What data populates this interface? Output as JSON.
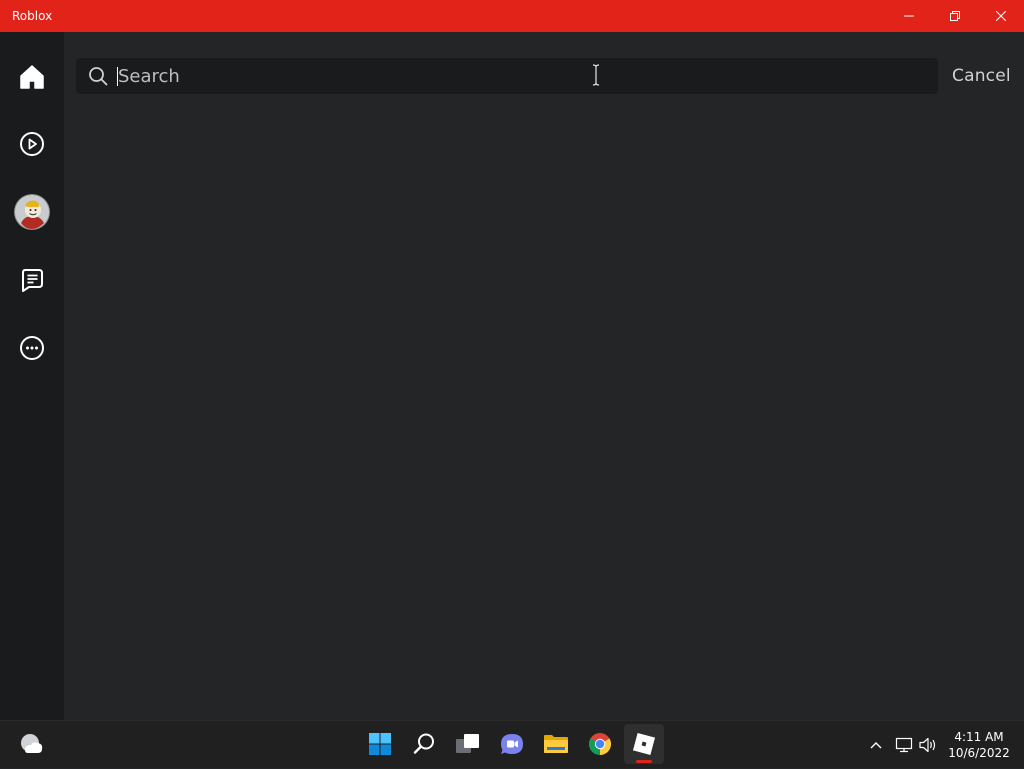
{
  "window": {
    "title": "Roblox",
    "accent_color": "#e2231a"
  },
  "sidebar": {
    "items": [
      {
        "name": "home",
        "icon": "home-icon"
      },
      {
        "name": "play",
        "icon": "play-icon"
      },
      {
        "name": "avatar",
        "icon": "avatar-icon"
      },
      {
        "name": "chat",
        "icon": "chat-icon"
      },
      {
        "name": "more",
        "icon": "more-icon"
      }
    ]
  },
  "search": {
    "placeholder": "Search",
    "value": "",
    "cancel_label": "Cancel"
  },
  "taskbar": {
    "apps": [
      "widgets-icon",
      "start-icon",
      "search-icon",
      "task-view-icon",
      "chat-icon",
      "file-explorer-icon",
      "chrome-icon",
      "roblox-icon"
    ],
    "active_app": "roblox-icon",
    "clock": {
      "time": "4:11 AM",
      "date": "10/6/2022"
    }
  }
}
